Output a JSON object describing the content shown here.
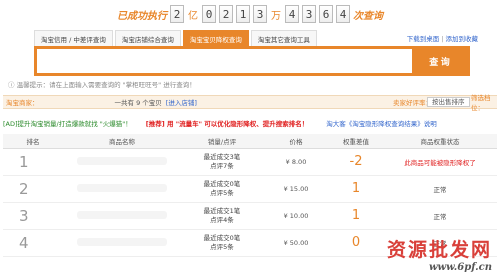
{
  "counter": {
    "prefix": "已成功执行",
    "digits": [
      "2",
      "0",
      "2",
      "1",
      "3",
      "4",
      "3",
      "6",
      "4"
    ],
    "units": [
      "亿",
      "万"
    ],
    "suffix": "次查询"
  },
  "tabs": [
    {
      "label": "淘宝信用 / 中差评查询",
      "active": false
    },
    {
      "label": "淘宝店铺综合查询",
      "active": false
    },
    {
      "label": "淘宝宝贝降权查询",
      "active": true
    },
    {
      "label": "淘宝其它查询工具",
      "active": false
    }
  ],
  "links": {
    "download": "下载到桌面",
    "favorite": "添加到收藏"
  },
  "search": {
    "value": "",
    "placeholder": "",
    "button": "查 询"
  },
  "hint": "温馨提示：请在上面输入需要查询的 \"掌柜旺旺号\" 进行查询！",
  "shop": {
    "label": "淘宝商家：",
    "count": "一共有 9 个宝贝",
    "enter": "[进入店铺]",
    "rate": "卖家好评率：",
    "sort": "按出售排序",
    "filter": "筛选档位："
  },
  "ads": {
    "a1": "[AD]提升淘宝销量/打造爆款就找 \"火爆猫\"！",
    "a2": "[推荐] 用 \"流量车\" 可以优化隐形降权、提升搜索排名！",
    "a3": "淘大客《淘宝隐形降权查询结果》说明"
  },
  "table": {
    "headers": [
      "排名",
      "商品名称",
      "销量/点评",
      "价格",
      "权重差值",
      "商品权重状态"
    ],
    "rows": [
      {
        "rank": "1",
        "sales1": "最近成交3笔",
        "sales2": "点评7条",
        "price": "¥ 8.00",
        "weight": "-2",
        "status": "此商品可能被隐形降权了"
      },
      {
        "rank": "2",
        "sales1": "最近成交0笔",
        "sales2": "点评5条",
        "price": "¥ 15.00",
        "weight": "1",
        "status": "正常"
      },
      {
        "rank": "3",
        "sales1": "最近成交1笔",
        "sales2": "点评4条",
        "price": "¥ 10.00",
        "weight": "1",
        "status": "正常"
      },
      {
        "rank": "4",
        "sales1": "最近成交0笔",
        "sales2": "点评5条",
        "price": "¥ 50.00",
        "weight": "0",
        "status": "正常"
      }
    ]
  },
  "watermark": {
    "big": "资源批发网",
    "small": "www.6pf.cn"
  },
  "colors": {
    "accent": "#e8862a",
    "link": "#3366cc",
    "alert": "#e02020"
  }
}
